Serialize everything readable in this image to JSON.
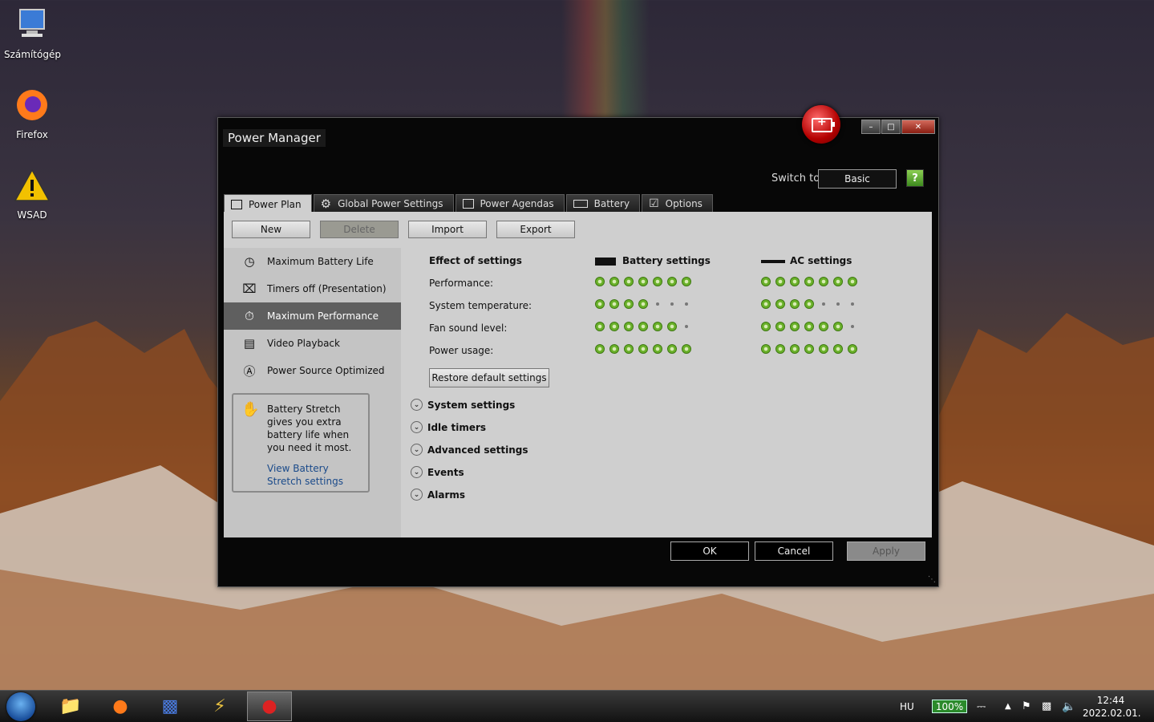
{
  "desktop": {
    "icons": [
      {
        "label": "Számítógép",
        "icon": "computer-icon"
      },
      {
        "label": "Firefox",
        "icon": "firefox-icon"
      },
      {
        "label": "WSAD",
        "icon": "warning-icon"
      }
    ]
  },
  "window": {
    "title": "Power Manager",
    "switch_label": "Switch to:",
    "switch_value": "Basic",
    "help_label": "?"
  },
  "tabs": [
    {
      "label": "Power Plan",
      "active": true
    },
    {
      "label": "Global Power Settings",
      "active": false
    },
    {
      "label": "Power Agendas",
      "active": false
    },
    {
      "label": "Battery",
      "active": false
    },
    {
      "label": "Options",
      "active": false
    }
  ],
  "toolbar": {
    "new_label": "New",
    "delete_label": "Delete",
    "import_label": "Import",
    "export_label": "Export"
  },
  "plans": [
    {
      "label": "Maximum Battery Life",
      "icon": "battery-clock-icon",
      "selected": false
    },
    {
      "label": "Timers off (Presentation)",
      "icon": "projector-icon",
      "selected": false
    },
    {
      "label": "Maximum Performance",
      "icon": "stopwatch-icon",
      "selected": true
    },
    {
      "label": "Video Playback",
      "icon": "film-icon",
      "selected": false
    },
    {
      "label": "Power Source Optimized",
      "icon": "auto-icon",
      "selected": false
    }
  ],
  "stretch": {
    "text": "Battery Stretch gives you extra battery life when you need it most.",
    "link": "View Battery Stretch settings"
  },
  "effects": {
    "header": "Effect of settings",
    "battery_header": "Battery settings",
    "ac_header": "AC settings",
    "rows": [
      {
        "label": "Performance:",
        "battery": 7,
        "ac": 7
      },
      {
        "label": "System temperature:",
        "battery": 4,
        "ac": 4
      },
      {
        "label": "Fan sound level:",
        "battery": 6,
        "ac": 6
      },
      {
        "label": "Power usage:",
        "battery": 7,
        "ac": 7
      }
    ],
    "scale_max": 7,
    "restore_label": "Restore default settings"
  },
  "sections": [
    "System settings",
    "Idle timers",
    "Advanced settings",
    "Events",
    "Alarms"
  ],
  "footer": {
    "ok_label": "OK",
    "cancel_label": "Cancel",
    "apply_label": "Apply"
  },
  "taskbar": {
    "language": "HU",
    "battery_percent": "100%",
    "time": "12:44",
    "date": "2022.02.01."
  },
  "colors": {
    "dot_green": "#6ab12a",
    "selected_plan": "#5f5f5f",
    "link": "#1a4a8a"
  }
}
